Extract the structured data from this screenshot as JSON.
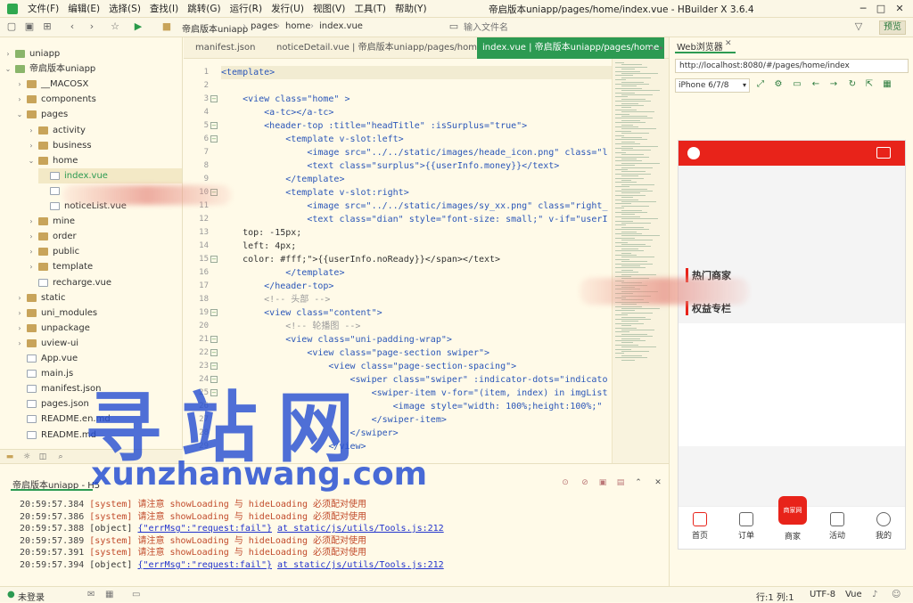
{
  "menu": [
    "文件(F)",
    "编辑(E)",
    "选择(S)",
    "查找(I)",
    "跳转(G)",
    "运行(R)",
    "发行(U)",
    "视图(V)",
    "工具(T)",
    "帮助(Y)"
  ],
  "window_title": "帝启版本uniapp/pages/home/index.vue - HBuilder X 3.6.4",
  "breadcrumb": [
    "帝启版本uniapp",
    "pages",
    "home",
    "index.vue"
  ],
  "search": {
    "placeholder": "输入文件名"
  },
  "preview_label": "预览",
  "tree": [
    {
      "label": "uniapp",
      "type": "proj"
    },
    {
      "label": "帝启版本uniapp",
      "type": "proj"
    },
    {
      "label": "__MACOSX",
      "type": "folder"
    },
    {
      "label": "components",
      "type": "folder"
    },
    {
      "label": "pages",
      "type": "folder"
    },
    {
      "label": "activity",
      "type": "folder"
    },
    {
      "label": "business",
      "type": "folder"
    },
    {
      "label": "home",
      "type": "folder"
    },
    {
      "label": "index.vue",
      "type": "file"
    },
    {
      "label": "",
      "type": "file"
    },
    {
      "label": "noticeList.vue",
      "type": "file"
    },
    {
      "label": "mine",
      "type": "folder"
    },
    {
      "label": "order",
      "type": "folder"
    },
    {
      "label": "public",
      "type": "folder"
    },
    {
      "label": "template",
      "type": "folder"
    },
    {
      "label": "recharge.vue",
      "type": "file"
    },
    {
      "label": "static",
      "type": "folder"
    },
    {
      "label": "uni_modules",
      "type": "folder"
    },
    {
      "label": "unpackage",
      "type": "folder"
    },
    {
      "label": "uview-ui",
      "type": "folder"
    },
    {
      "label": "App.vue",
      "type": "file"
    },
    {
      "label": "main.js",
      "type": "file"
    },
    {
      "label": "manifest.json",
      "type": "file"
    },
    {
      "label": "pages.json",
      "type": "file"
    },
    {
      "label": "README.en.md",
      "type": "file"
    },
    {
      "label": "README.md",
      "type": "file"
    }
  ],
  "editor_tabs": [
    "manifest.json",
    "noticeDetail.vue | 帝启版本uniapp/pages/home",
    "index.vue | 帝启版本uniapp/pages/home"
  ],
  "line_numbers": [
    "1",
    "2",
    "3",
    "4",
    "5",
    "6",
    "7",
    "8",
    "9",
    "10",
    "11",
    "12",
    "13",
    "14",
    "15",
    "16",
    "17",
    "18",
    "19",
    "20",
    "21",
    "22",
    "23",
    "24",
    "25",
    "26",
    "27",
    "28",
    "29"
  ],
  "code_lines": [
    "<template>",
    "",
    "    <view class=\"home\" >",
    "        <a-tc></a-tc>",
    "        <header-top :title=\"headTitle\" :isSurplus=\"true\">",
    "            <template v-slot:left>",
    "                <image src=\"../../static/images/heade_icon.png\" class=\"l",
    "                <text class=\"surplus\">{{userInfo.money}}</text>",
    "            </template>",
    "            <template v-slot:right>",
    "                <image src=\"../../static/images/sy_xx.png\" class=\"right_",
    "                <text class=\"dian\" style=\"font-size: small;\" v-if=\"userI",
    "    top: -15px;",
    "    left: 4px;",
    "    color: #fff;\">{{userInfo.noReady}}</span></text>",
    "            </template>",
    "        </header-top>",
    "        <!-- 头部 -->",
    "        <view class=\"content\">",
    "            <!-- 轮播图 -->",
    "            <view class=\"uni-padding-wrap\">",
    "                <view class=\"page-section swiper\">",
    "                    <view class=\"page-section-spacing\">",
    "                        <swiper class=\"swiper\" :indicator-dots=\"indicato",
    "                            <swiper-item v-for=\"(item, index) in imgList",
    "                                <image style=\"width: 100%;height:100%;\"",
    "                            </swiper-item>",
    "                        </swiper>",
    "                    </view>"
  ],
  "console": {
    "title": "帝启版本uniapp - H5",
    "logs": [
      {
        "ts": "20:59:57.384",
        "type": "[system]",
        "msg": "请注意 showLoading 与 hideLoading 必须配对使用",
        "link": ""
      },
      {
        "ts": "20:59:57.386",
        "type": "[system]",
        "msg": "请注意 showLoading 与 hideLoading 必须配对使用",
        "link": ""
      },
      {
        "ts": "20:59:57.388",
        "type": "[object]",
        "msg": "{\"errMsg\":\"request:fail\"}",
        "link": "at static/js/utils/Tools.js:212"
      },
      {
        "ts": "20:59:57.389",
        "type": "[system]",
        "msg": "请注意 showLoading 与 hideLoading 必须配对使用",
        "link": ""
      },
      {
        "ts": "20:59:57.391",
        "type": "[system]",
        "msg": "请注意 showLoading 与 hideLoading 必须配对使用",
        "link": ""
      },
      {
        "ts": "20:59:57.394",
        "type": "[object]",
        "msg": "{\"errMsg\":\"request:fail\"}",
        "link": "at static/js/utils/Tools.js:212"
      }
    ]
  },
  "browser": {
    "tab": "Web浏览器",
    "url": "http://localhost:8080/#/pages/home/index",
    "device": "iPhone 6/7/8"
  },
  "phone": {
    "section_hot": "热门商家",
    "section_benefit": "权益专栏",
    "center_badge": "商家网",
    "nav": [
      "首页",
      "订单",
      "商家",
      "活动",
      "我的"
    ]
  },
  "status": {
    "login": "未登录",
    "position": "行:1  列:1",
    "encoding": "UTF-8",
    "language": "Vue"
  },
  "watermark": {
    "cn": "寻站网",
    "en": "xunzhanwang.com"
  },
  "colors": {
    "accent": "#2c9a52",
    "phone_brand": "#e8231a",
    "background": "#fffae8"
  }
}
